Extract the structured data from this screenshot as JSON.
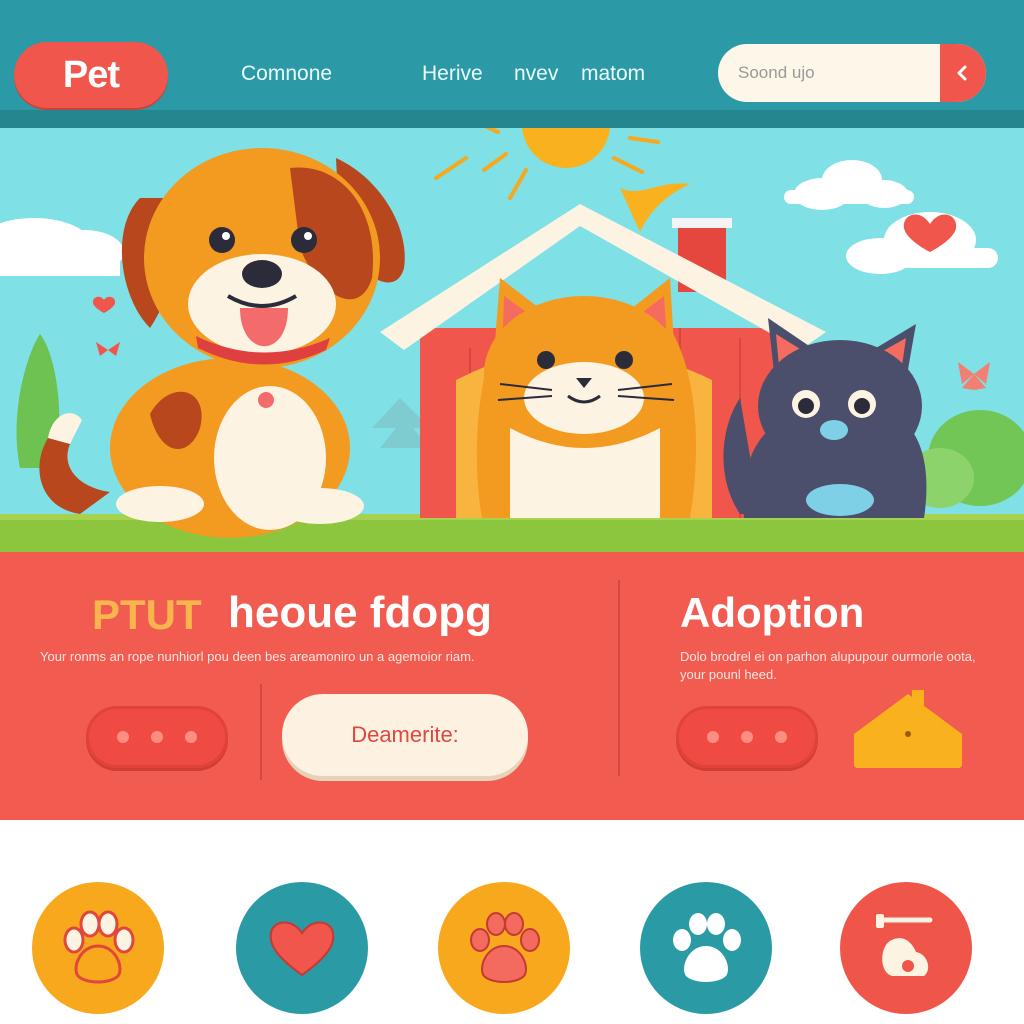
{
  "header": {
    "logo": "Pet",
    "nav": [
      "Comnone",
      "Herive",
      "nvev",
      "matom"
    ],
    "search_placeholder": "Soond ujo"
  },
  "promo": {
    "tag": "PTUT",
    "heading": "heoue fdopg",
    "description": "Your ronms an rope nunhiorl pou deen bes areamoniro un a agemoior riam.",
    "cta_label": "Deamerite:"
  },
  "adoption": {
    "heading": "Adoption",
    "description": "Dolo brodrel ei on parhon alupupour ourmorle oota, your pounl heed."
  },
  "features": [
    {
      "icon": "paw-icon",
      "color": "#f7a81c"
    },
    {
      "icon": "heart-icon",
      "color": "#2a9aa5"
    },
    {
      "icon": "paw-icon",
      "color": "#f7a81c"
    },
    {
      "icon": "paw-icon",
      "color": "#2a9aa5"
    },
    {
      "icon": "pet-bowl-icon",
      "color": "#f0554a"
    }
  ],
  "colors": {
    "header": "#2b9aa6",
    "accent": "#f0564c",
    "band": "#f25b4f",
    "sky": "#7fe0e6"
  }
}
